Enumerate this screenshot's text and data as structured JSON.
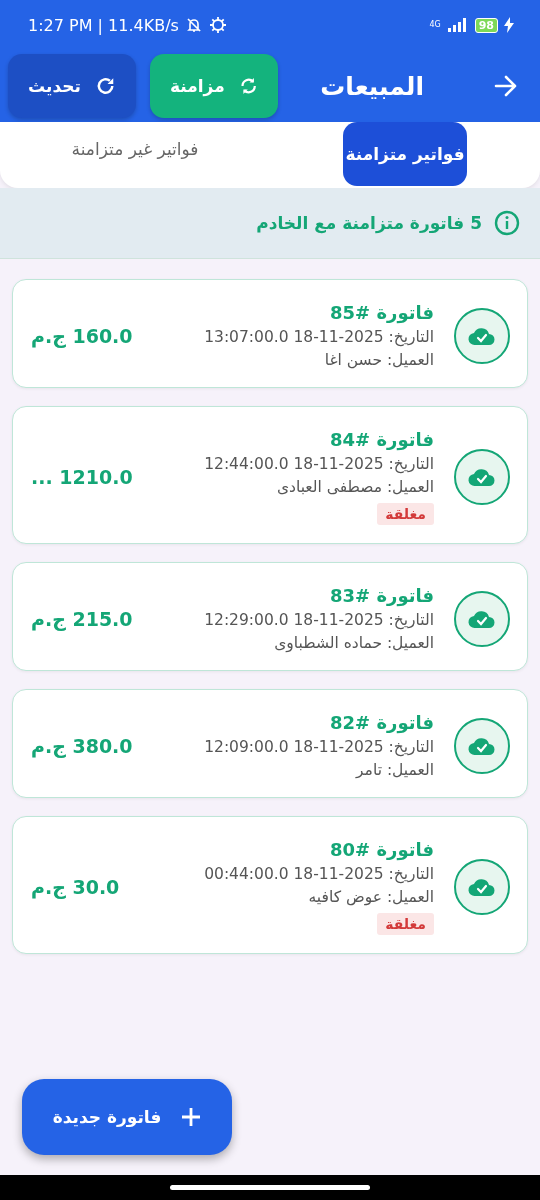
{
  "status_bar": {
    "time": "1:27 PM | 11.4KB/s",
    "network": "4G",
    "battery": "98"
  },
  "app_bar": {
    "title": "المبيعات",
    "buttons": [
      {
        "label": "مزامنة",
        "kind": "sync"
      },
      {
        "label": "تحديث",
        "kind": "refresh"
      }
    ]
  },
  "tabs": [
    {
      "label": "فواتير متزامنة",
      "selected": true
    },
    {
      "label": "فواتير غير متزامنة",
      "selected": false
    }
  ],
  "info_banner": "5 فاتورة متزامنة مع الخادم",
  "invoices": [
    {
      "title": "فاتورة #85",
      "date": "التاريخ: 2025-11-18 13:07:00.0",
      "customer": "العميل: حسن اغا",
      "amount": "160.0 ج.م"
    },
    {
      "title": "فاتورة #84",
      "date": "التاريخ: 2025-11-18 12:44:00.0",
      "customer": "العميل: مصطفى العبادى",
      "amount": "1210.0 ...",
      "tag": "مغلقة"
    },
    {
      "title": "فاتورة #83",
      "date": "التاريخ: 2025-11-18 12:29:00.0",
      "customer": "العميل: حماده الشطباوى",
      "amount": "215.0 ج.م"
    },
    {
      "title": "فاتورة #82",
      "date": "التاريخ: 2025-11-18 12:09:00.0",
      "customer": "العميل: تامر",
      "amount": "380.0 ج.م"
    },
    {
      "title": "فاتورة #80",
      "date": "التاريخ: 2025-11-18 00:44:00.0",
      "customer": "العميل: عوض كافيه",
      "amount": "30.0 ج.م",
      "tag": "مغلقة"
    }
  ],
  "fab": {
    "label": "فاتورة جديدة"
  }
}
